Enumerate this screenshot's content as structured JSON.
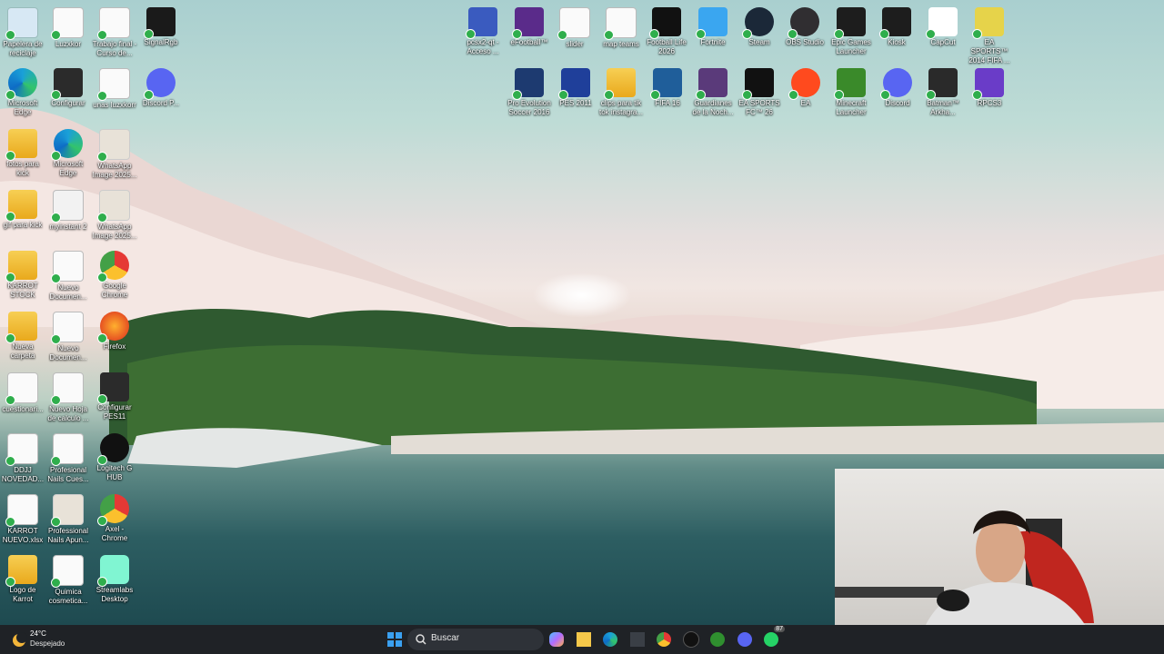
{
  "desktop": {
    "icons_left": [
      {
        "label": "Papelera de reciclaje",
        "icon": "recycle-bin-icon"
      },
      {
        "label": "Luzxkor",
        "icon": "document-icon"
      },
      {
        "label": "Trabajo final - Curso de...",
        "icon": "chrome-document-icon"
      },
      {
        "label": "SignalRgb",
        "icon": "signalrgb-icon"
      },
      {
        "label": "Microsoft Edge",
        "icon": "edge-icon"
      },
      {
        "label": "Configurar",
        "icon": "pes-config-icon"
      },
      {
        "label": "unas luzxkorr",
        "icon": "document-icon"
      },
      {
        "label": "Discord P...",
        "icon": "discord-icon"
      },
      {
        "label": "fotos para kick",
        "icon": "folder-icon"
      },
      {
        "label": "Microsoft Edge",
        "icon": "edge-icon"
      },
      {
        "label": "WhatsApp Image 2025...",
        "icon": "image-icon"
      },
      {
        "label": "gif para kick",
        "icon": "folder-icon"
      },
      {
        "label": "myinstant 2",
        "icon": "media-icon"
      },
      {
        "label": "WhatsApp Image 2025...",
        "icon": "image-icon"
      },
      {
        "label": "KARROT STOCK",
        "icon": "folder-icon"
      },
      {
        "label": "Nuevo Documen...",
        "icon": "document-icon"
      },
      {
        "label": "Google Chrome",
        "icon": "chrome-icon"
      },
      {
        "label": "Nueva carpeta",
        "icon": "folder-icon"
      },
      {
        "label": "Nuevo Documen...",
        "icon": "document-icon"
      },
      {
        "label": "Firefox",
        "icon": "firefox-icon"
      },
      {
        "label": "cuestionari...",
        "icon": "document-icon"
      },
      {
        "label": "Nuevo Hoja de calculo ...",
        "icon": "spreadsheet-icon"
      },
      {
        "label": "Configurar PES11",
        "icon": "pes-config-icon"
      },
      {
        "label": "DDJJ NOVEDAD...",
        "icon": "chrome-document-icon"
      },
      {
        "label": "Profesional Nails Cues...",
        "icon": "chrome-document-icon"
      },
      {
        "label": "Logitech G HUB",
        "icon": "logitech-icon"
      },
      {
        "label": "KARROT NUEVO.xlsx",
        "icon": "document-icon"
      },
      {
        "label": "Professional Nails Apun...",
        "icon": "image-icon"
      },
      {
        "label": "Axel - Chrome",
        "icon": "chrome-icon"
      },
      {
        "label": "Logo de Karrot",
        "icon": "folder-icon"
      },
      {
        "label": "Quimica cosmetica...",
        "icon": "document-icon"
      },
      {
        "label": "Streamlabs Desktop",
        "icon": "streamlabs-icon"
      }
    ],
    "icons_top": [
      {
        "label": "pcsx2-qt - Acceso ...",
        "icon": "pcsx2-icon"
      },
      {
        "label": "eFootball™",
        "icon": "efootball-icon"
      },
      {
        "label": "slider",
        "icon": "document-icon"
      },
      {
        "label": "map teams",
        "icon": "document-icon"
      },
      {
        "label": "Football Life 2026",
        "icon": "football-life-icon"
      },
      {
        "label": "Fortnite",
        "icon": "fortnite-icon"
      },
      {
        "label": "Steam",
        "icon": "steam-icon"
      },
      {
        "label": "OBS Studio",
        "icon": "obs-icon"
      },
      {
        "label": "Epic Games Launcher",
        "icon": "epic-games-icon"
      },
      {
        "label": "Kiosk",
        "icon": "kiosk-icon"
      },
      {
        "label": "CapCut",
        "icon": "capcut-icon"
      },
      {
        "label": "EA SPORTS™ 2014 FIFA ...",
        "icon": "fifa-icon"
      },
      {
        "label": "Pro Evolution Soccer 2016",
        "icon": "pes2016-icon"
      },
      {
        "label": "PES 2011",
        "icon": "pes2011-icon"
      },
      {
        "label": "clips para tik tok instagra...",
        "icon": "folder-icon"
      },
      {
        "label": "FIFA 16",
        "icon": "fifa16-icon"
      },
      {
        "label": "Guardianes de la Noch...",
        "icon": "game-icon"
      },
      {
        "label": "EA SPORTS FC™ 26",
        "icon": "fc26-icon"
      },
      {
        "label": "EA",
        "icon": "ea-icon"
      },
      {
        "label": "Minecraft Launcher",
        "icon": "minecraft-icon"
      },
      {
        "label": "Discord",
        "icon": "discord-icon"
      },
      {
        "label": "Batman™ Arkha...",
        "icon": "batman-icon"
      },
      {
        "label": "RPCS3",
        "icon": "rpcs3-icon"
      }
    ]
  },
  "taskbar": {
    "weather": {
      "temperature": "24°C",
      "condition": "Despejado",
      "icon": "moon-icon"
    },
    "start_icon": "windows-start-icon",
    "search": {
      "placeholder": "Buscar",
      "icon": "search-icon"
    },
    "apps": [
      {
        "name": "copilot-icon"
      },
      {
        "name": "file-explorer-icon"
      },
      {
        "name": "edge-icon"
      },
      {
        "name": "store-icon"
      },
      {
        "name": "chrome-icon"
      },
      {
        "name": "logitech-icon"
      },
      {
        "name": "xbox-icon"
      },
      {
        "name": "discord-icon"
      },
      {
        "name": "whatsapp-icon",
        "badge": "87"
      }
    ]
  },
  "colors": {
    "taskbar_bg": "#1f2226",
    "label_text": "#ffffff",
    "check_green": "#2fae4c"
  }
}
